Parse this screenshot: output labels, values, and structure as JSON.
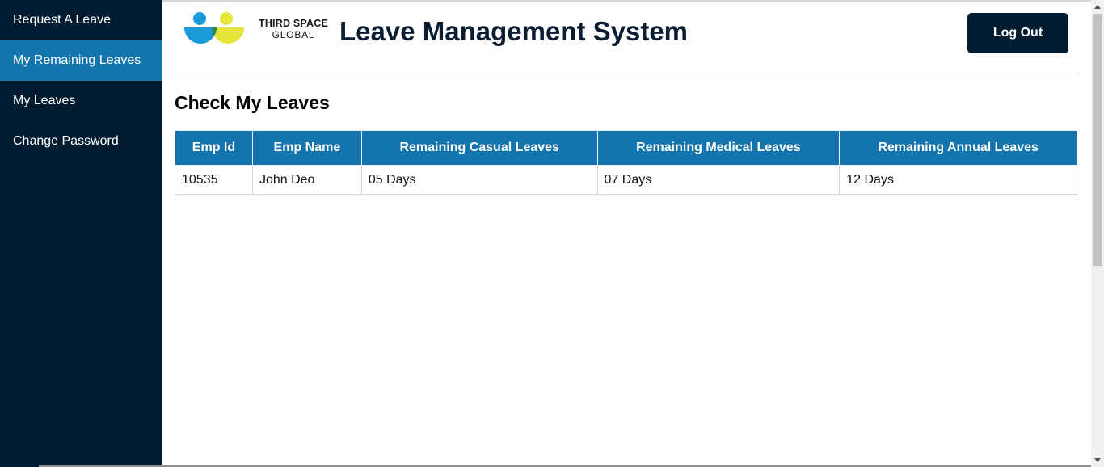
{
  "sidebar": {
    "items": [
      {
        "label": "Request A Leave"
      },
      {
        "label": "My Remaining Leaves",
        "active": true
      },
      {
        "label": "My Leaves"
      },
      {
        "label": "Change Password"
      }
    ]
  },
  "header": {
    "logo": {
      "line1": "THIRD SPACE",
      "line2": "GLOBAL"
    },
    "title": "Leave Management System",
    "logout_label": "Log Out"
  },
  "main": {
    "page_title": "Check My Leaves",
    "table": {
      "columns": [
        "Emp Id",
        "Emp Name",
        "Remaining Casual Leaves",
        "Remaining Medical Leaves",
        "Remaining Annual Leaves"
      ],
      "rows": [
        [
          "10535",
          "John Deo",
          "05 Days",
          "07 Days",
          "12 Days"
        ]
      ]
    }
  },
  "colors": {
    "sidebar_bg": "#011b30",
    "accent": "#1474ad",
    "logo_blue": "#1b9ad8",
    "logo_yellow": "#e5e43a",
    "logo_green": "#27885a"
  }
}
